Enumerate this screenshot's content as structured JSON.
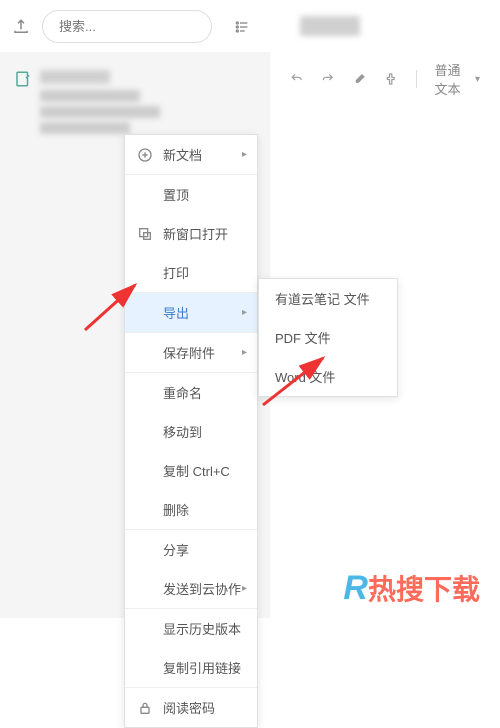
{
  "search": {
    "placeholder": "搜索..."
  },
  "toolbar": {
    "text_style": "普通文本"
  },
  "menu": {
    "new_doc": "新文档",
    "pin": "置顶",
    "new_window": "新窗口打开",
    "print": "打印",
    "export": "导出",
    "save_attachment": "保存附件",
    "rename": "重命名",
    "move_to": "移动到",
    "copy": "复制 Ctrl+C",
    "delete": "删除",
    "share": "分享",
    "send_cloud": "发送到云协作",
    "history": "显示历史版本",
    "copy_link": "复制引用链接",
    "read_password": "阅读密码"
  },
  "submenu": {
    "youdao": "有道云笔记 文件",
    "pdf": "PDF 文件",
    "word": "Word 文件"
  },
  "watermark": "热搜下载"
}
